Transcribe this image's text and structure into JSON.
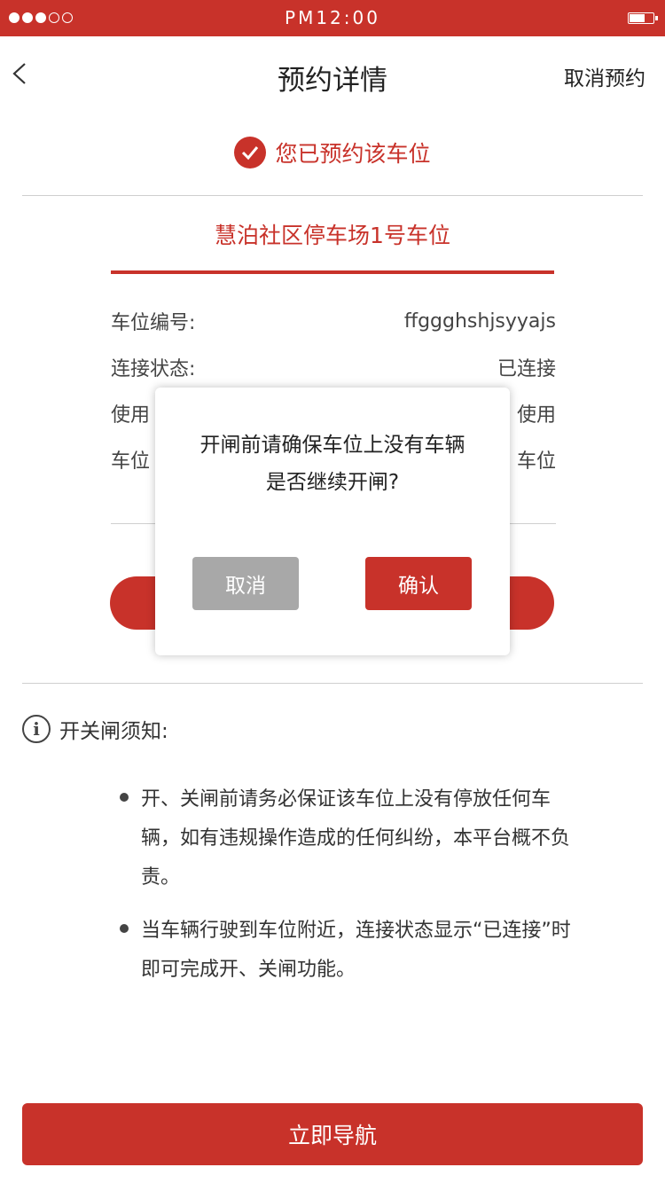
{
  "status_bar": {
    "time": "PM12:00",
    "signal_icon": "signal-dots-icon",
    "battery_icon": "battery-icon"
  },
  "nav": {
    "back_icon": "chevron-left-icon",
    "title": "预约详情",
    "action": "取消预约"
  },
  "reservation": {
    "status_icon": "check-circle-icon",
    "status_text": "您已预约该车位"
  },
  "lot": {
    "name": "慧泊社区停车场1号车位"
  },
  "info": {
    "spot_number_label": "车位编号:",
    "spot_number_value": "ffggghshjsyyajs",
    "connection_label": "连接状态:",
    "connection_value": "已连接",
    "usage_label": "使用",
    "usage_value": "使用",
    "spot_label": "车位",
    "spot_value": "车位"
  },
  "notice": {
    "icon": "info-circle-icon",
    "title": "开关闸须知:",
    "items": [
      "开、关闸前请务必保证该车位上没有停放任何车辆，如有违规操作造成的任何纠纷，本平台概不负责。",
      "当车辆行驶到车位附近，连接状态显示“已连接”时即可完成开、关闸功能。"
    ]
  },
  "footer": {
    "navigate_label": "立即导航"
  },
  "dialog": {
    "line1": "开闸前请确保车位上没有车辆",
    "line2": "是否继续开闸?",
    "cancel_label": "取消",
    "confirm_label": "确认"
  },
  "colors": {
    "accent": "#c8322a",
    "cancel_gray": "#a8a8a8"
  }
}
